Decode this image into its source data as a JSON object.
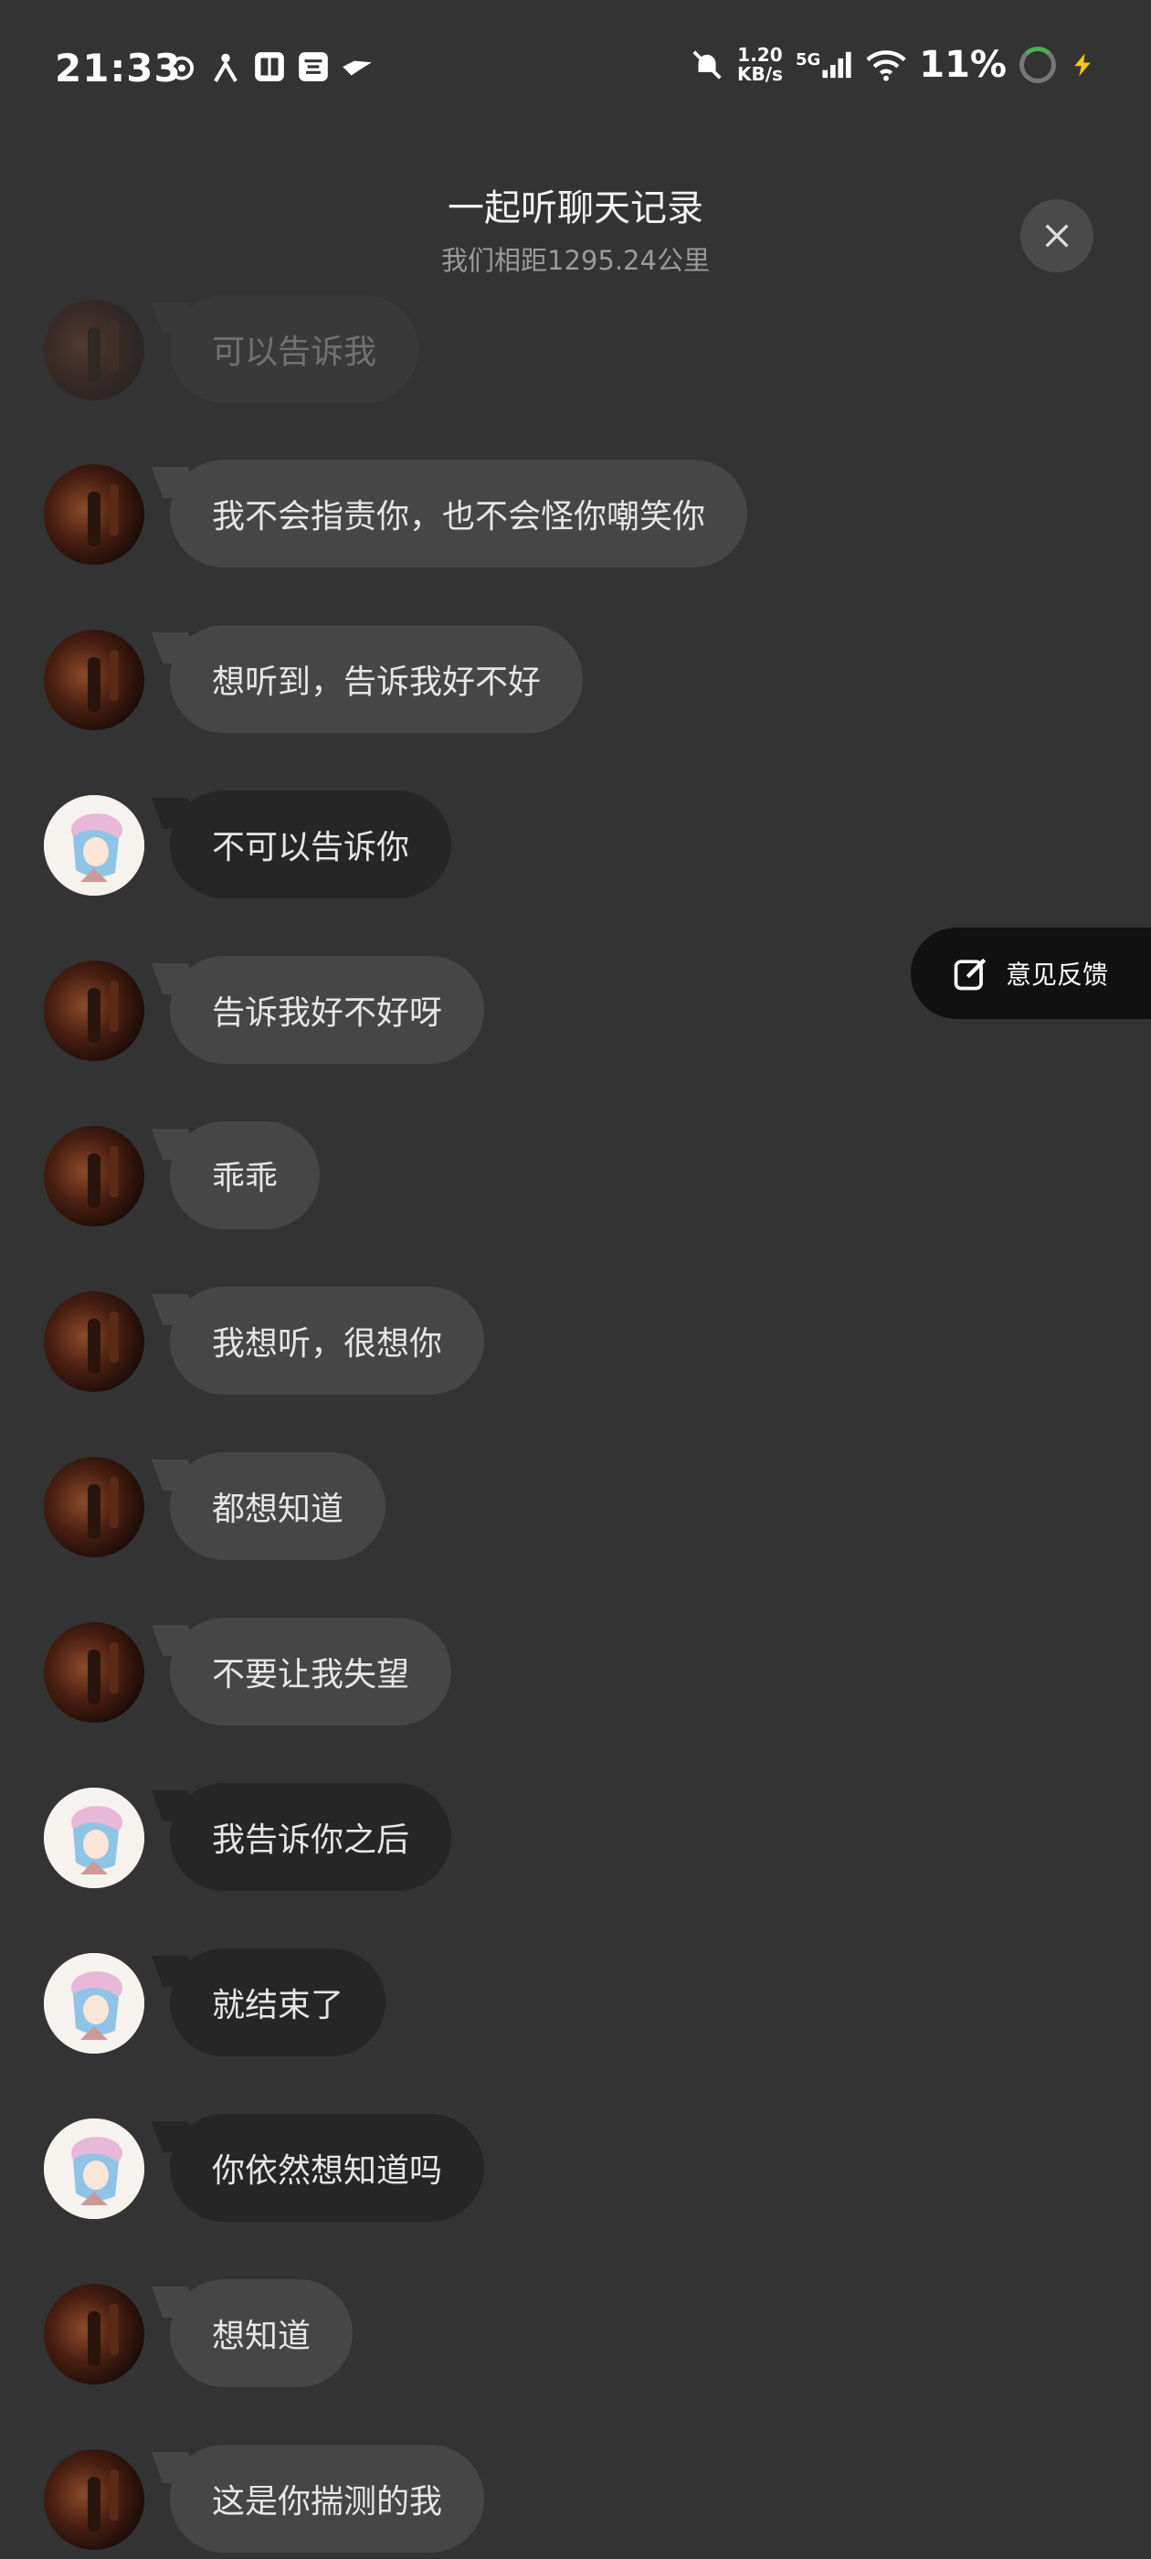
{
  "status_bar": {
    "time": "21:33",
    "net_speed_value": "1.20",
    "net_speed_unit": "KB/s",
    "network": "5G",
    "battery": "11%",
    "icons_left": [
      "weibo-icon",
      "person-icon",
      "tieba-icon",
      "taobao-icon",
      "bird-icon"
    ],
    "icons_right": [
      "bell-off-icon",
      "signal-icon",
      "wifi-icon",
      "battery-ring-icon",
      "charging-icon"
    ]
  },
  "header": {
    "title": "一起听聊天记录",
    "subtitle": "我们相距1295.24公里",
    "close_icon": "close-icon"
  },
  "feedback": {
    "label": "意见反馈",
    "icon": "edit-icon"
  },
  "colors": {
    "background": "#333333",
    "bubble_other": "#464646",
    "bubble_self": "#262626",
    "feedback_bg": "#111111"
  },
  "messages": [
    {
      "text": "可以告诉我",
      "avatar": "dark"
    },
    {
      "text": "我不会指责你，也不会怪你嘲笑你",
      "avatar": "dark"
    },
    {
      "text": "想听到，告诉我好不好",
      "avatar": "dark"
    },
    {
      "text": "不可以告诉你",
      "avatar": "anime"
    },
    {
      "text": "告诉我好不好呀",
      "avatar": "dark"
    },
    {
      "text": "乖乖",
      "avatar": "dark"
    },
    {
      "text": "我想听，很想你",
      "avatar": "dark"
    },
    {
      "text": "都想知道",
      "avatar": "dark"
    },
    {
      "text": "不要让我失望",
      "avatar": "dark"
    },
    {
      "text": "我告诉你之后",
      "avatar": "anime"
    },
    {
      "text": "就结束了",
      "avatar": "anime"
    },
    {
      "text": "你依然想知道吗",
      "avatar": "anime"
    },
    {
      "text": "想知道",
      "avatar": "dark"
    },
    {
      "text": "这是你揣测的我",
      "avatar": "dark"
    }
  ]
}
